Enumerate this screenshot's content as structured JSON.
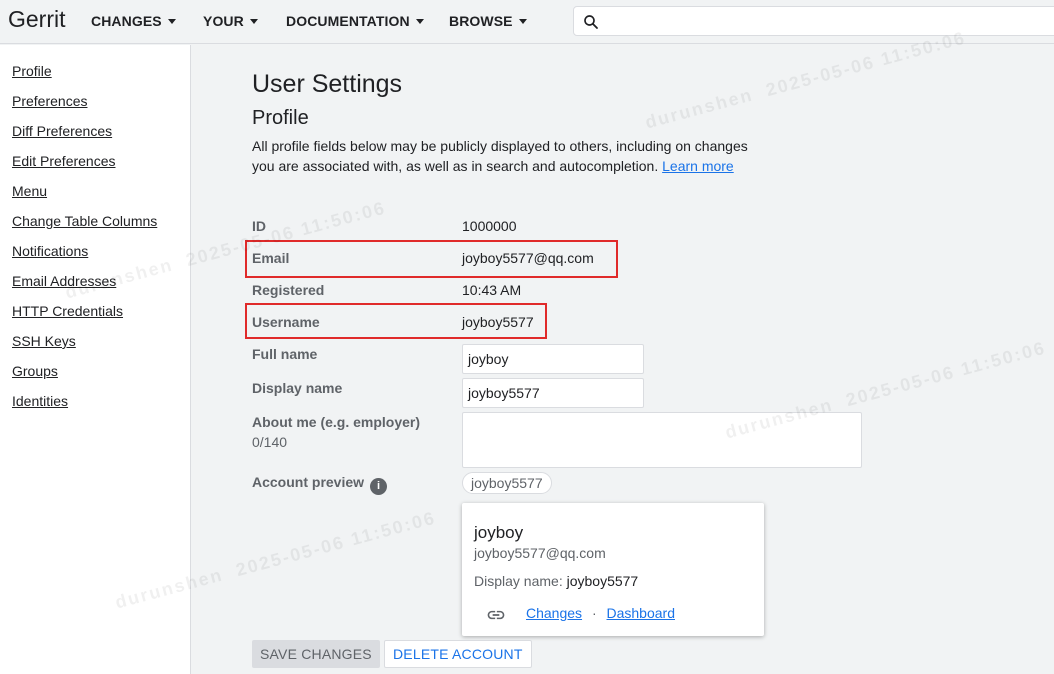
{
  "header": {
    "brand": "Gerrit",
    "nav": [
      "CHANGES",
      "YOUR",
      "DOCUMENTATION",
      "BROWSE"
    ],
    "search_placeholder": ""
  },
  "sidebar": {
    "items": [
      {
        "label": "Profile"
      },
      {
        "label": "Preferences"
      },
      {
        "label": "Diff Preferences"
      },
      {
        "label": "Edit Preferences"
      },
      {
        "label": "Menu"
      },
      {
        "label": "Change Table Columns"
      },
      {
        "label": "Notifications"
      },
      {
        "label": "Email Addresses"
      },
      {
        "label": "HTTP Credentials"
      },
      {
        "label": "SSH Keys"
      },
      {
        "label": "Groups"
      },
      {
        "label": "Identities"
      }
    ]
  },
  "main": {
    "title": "User Settings",
    "section": "Profile",
    "description": "All profile fields below may be publicly displayed to others, including on changes you are associated with, as well as in search and autocompletion.",
    "learn_more": "Learn more",
    "fields": {
      "id_label": "ID",
      "id_value": "1000000",
      "email_label": "Email",
      "email_value": "joyboy5577@qq.com",
      "registered_label": "Registered",
      "registered_value": "10:43 AM",
      "username_label": "Username",
      "username_value": "joyboy5577",
      "fullname_label": "Full name",
      "fullname_value": "joyboy",
      "displayname_label": "Display name",
      "displayname_value": "joyboy5577",
      "about_label": "About me (e.g. employer)",
      "about_counter": "0/140",
      "preview_label": "Account preview"
    },
    "preview": {
      "chip": "joyboy5577",
      "name": "joyboy",
      "email": "joyboy5577@qq.com",
      "display_prefix": "Display name: ",
      "display_value": "joyboy5577",
      "link_changes": "Changes",
      "separator": "·",
      "link_dashboard": "Dashboard"
    },
    "buttons": {
      "save": "SAVE CHANGES",
      "delete": "DELETE ACCOUNT"
    }
  },
  "watermark": {
    "user": "durunshen",
    "stamp": "2025-05-06  11:50:06"
  }
}
